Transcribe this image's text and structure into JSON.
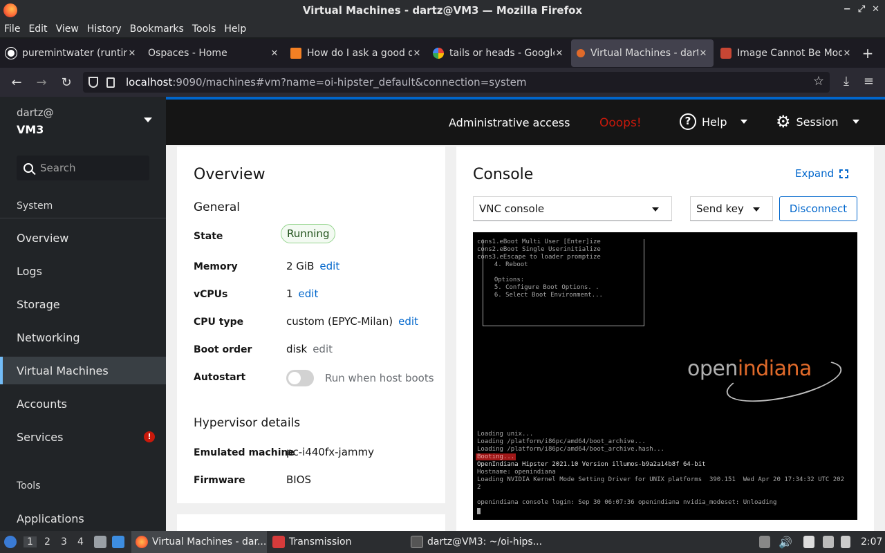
{
  "window": {
    "title": "Virtual Machines - dartz@VM3 — Mozilla Firefox",
    "controls": [
      "−",
      "⤢",
      "✕"
    ]
  },
  "menu": [
    "File",
    "Edit",
    "View",
    "History",
    "Bookmarks",
    "Tools",
    "Help"
  ],
  "tabs": [
    {
      "label": "puremintwater (runtim",
      "close": "✕"
    },
    {
      "label": "Ospaces - Home",
      "close": "✕"
    },
    {
      "label": "How do I ask a good q",
      "close": "✕"
    },
    {
      "label": "tails or heads - Google",
      "close": "✕"
    },
    {
      "label": "Virtual Machines - dart",
      "close": "✕"
    },
    {
      "label": "Image Cannot Be Modi",
      "close": "✕"
    }
  ],
  "new_tab": "+",
  "url": {
    "host": "localhost",
    "rest": ":9090/machines#vm?name=oi-hipster_default&connection=system"
  },
  "sidebar": {
    "user": "dartz@",
    "host": "VM3",
    "search_placeholder": "Search",
    "system_label": "System",
    "items": [
      "Overview",
      "Logs",
      "Storage",
      "Networking",
      "Virtual Machines",
      "Accounts",
      "Services"
    ],
    "services_badge": "!",
    "tools_label": "Tools",
    "tools_items": [
      "Applications"
    ]
  },
  "topbar": {
    "admin": "Administrative access",
    "ooops": "Ooops!",
    "help": "Help",
    "session": "Session"
  },
  "overview": {
    "title": "Overview",
    "general": "General",
    "state_label": "State",
    "state_value": "Running",
    "memory_label": "Memory",
    "memory_value": "2 GiB",
    "vcpus_label": "vCPUs",
    "vcpus_value": "1",
    "cputype_label": "CPU type",
    "cputype_value": "custom (EPYC-Milan)",
    "bootorder_label": "Boot order",
    "bootorder_value": "disk",
    "autostart_label": "Autostart",
    "autostart_text": "Run when host boots",
    "edit": "edit",
    "hypervisor": "Hypervisor details",
    "emulated_label": "Emulated machine",
    "emulated_value": "pc-i440fx-jammy",
    "firmware_label": "Firmware",
    "firmware_value": "BIOS"
  },
  "console": {
    "title": "Console",
    "expand": "Expand",
    "type_select": "VNC console",
    "send_key": "Send key",
    "disconnect": "Disconnect",
    "lines_top": [
      "cons1.eBoot Multi User [Enter]ize",
      "cons2.eBoot Single Userinitialize",
      "cons3.eEscape to loader promptize",
      "  4. Reboot",
      "",
      "  Options:",
      "  5. Configure Boot Options. .",
      "  6. Select Boot Environment..."
    ],
    "logo_a": "open",
    "logo_b": "indiana",
    "lines_bottom": [
      "Loading unix...",
      "Loading /platform/i86pc/amd64/boot_archive...",
      "Loading /platform/i86pc/amd64/boot_archive.hash..."
    ],
    "booting": "Booting...",
    "lines_after": [
      "OpenIndiana Hipster 2021.10 Version illumos-b9a2a14b8f 64-bit",
      "Hostname: openindiana",
      "Loading NVIDIA Kernel Mode Setting Driver for UNIX platforms  390.151  Wed Apr 20 17:34:32 UTC 202",
      "2",
      "",
      "openindiana console login: Sep 30 06:07:36 openindiana nvidia_modeset: Unloading"
    ]
  },
  "taskbar": {
    "workspaces": [
      "1",
      "2",
      "3",
      "4"
    ],
    "apps": [
      "Virtual Machines - dar...",
      "Transmission",
      "dartz@VM3: ~/oi-hips..."
    ],
    "clock": "2:07"
  }
}
